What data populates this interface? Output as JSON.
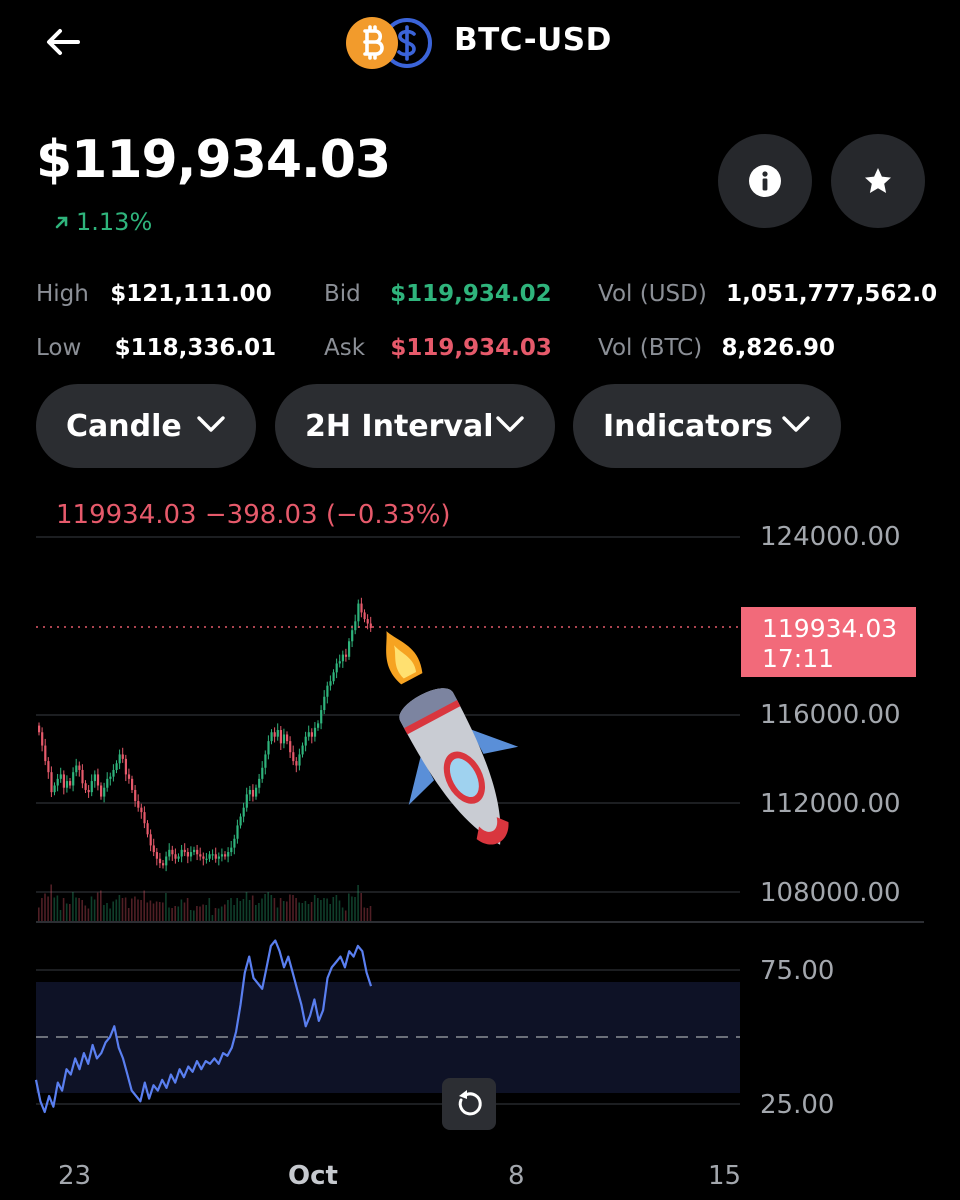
{
  "header": {
    "title": "BTC-USD",
    "coin_icons": [
      "bitcoin-icon",
      "dollar-icon"
    ]
  },
  "price": {
    "value": "$119,934.03",
    "change": "1.13%",
    "change_direction": "up"
  },
  "actions": {
    "info_icon": "info-icon",
    "favorite_icon": "star-icon"
  },
  "stats": {
    "high_label": "High",
    "high_value": "$121,111.00",
    "low_label": "Low",
    "low_value": "$118,336.01",
    "bid_label": "Bid",
    "bid_value": "$119,934.02",
    "ask_label": "Ask",
    "ask_value": "$119,934.03",
    "vol_usd_label": "Vol (USD)",
    "vol_usd_value": "1,051,777,562.0",
    "vol_btc_label": "Vol (BTC)",
    "vol_btc_value": "8,826.90"
  },
  "controls": {
    "chart_type": "Candle",
    "interval": "2H Interval",
    "indicators": "Indicators"
  },
  "chart": {
    "legend": "119934.03  −398.03 (−0.33%)",
    "price_axis": [
      "124000.00",
      "116000.00",
      "112000.00",
      "108000.00"
    ],
    "current_price_tag": "119934.03",
    "current_time_tag": "17:11",
    "rsi_axis": [
      "75.00",
      "25.00"
    ],
    "time_axis": [
      "23",
      "Oct",
      "8",
      "15"
    ]
  },
  "colors": {
    "up": "#2fb47c",
    "down": "#e65a6b",
    "rsi": "#5a7ff0",
    "background": "#000000",
    "pill": "#2b2d31"
  },
  "chart_data": {
    "type": "candlestick",
    "ylim": [
      107000,
      125000
    ],
    "y_ticks": [
      124000,
      116000,
      112000,
      108000
    ],
    "x_tick_labels": [
      "23",
      "Oct",
      "8",
      "15"
    ],
    "current_price": 119934.03,
    "close": [
      115200,
      114600,
      113900,
      113400,
      112500,
      112800,
      113100,
      113300,
      112700,
      113000,
      112800,
      113400,
      113700,
      113500,
      112900,
      112600,
      112500,
      113000,
      113300,
      112800,
      112300,
      112700,
      113100,
      113200,
      113500,
      113800,
      114200,
      114000,
      113300,
      113100,
      112600,
      112100,
      111800,
      111600,
      111100,
      110600,
      110100,
      109800,
      109500,
      109300,
      109200,
      109600,
      109900,
      109700,
      109500,
      109600,
      109900,
      109800,
      109600,
      109800,
      109900,
      109700,
      109600,
      109500,
      109500,
      109700,
      109700,
      109500,
      109600,
      109700,
      109600,
      109800,
      110000,
      110400,
      111000,
      111400,
      111800,
      112400,
      112600,
      112300,
      112700,
      113100,
      113600,
      114200,
      114800,
      115200,
      115000,
      115300,
      114700,
      115100,
      114800,
      114300,
      113900,
      113700,
      114200,
      114600,
      115000,
      115200,
      115000,
      115400,
      115600,
      116200,
      116800,
      117300,
      117500,
      117900,
      118300,
      118400,
      118700,
      118600,
      119300,
      119800,
      120200,
      121000,
      120600,
      120300,
      120100,
      119900
    ],
    "rsi": {
      "ylim": [
        10,
        90
      ],
      "levels": [
        75,
        50,
        25
      ],
      "values": [
        34,
        26,
        22,
        28,
        24,
        33,
        30,
        38,
        36,
        42,
        38,
        44,
        40,
        47,
        42,
        44,
        48,
        50,
        54,
        46,
        42,
        36,
        30,
        28,
        26,
        33,
        27,
        32,
        30,
        34,
        31,
        36,
        33,
        38,
        35,
        39,
        37,
        41,
        38,
        41,
        40,
        42,
        40,
        44,
        43,
        46,
        52,
        62,
        74,
        80,
        72,
        70,
        68,
        76,
        84,
        86,
        82,
        76,
        80,
        74,
        68,
        62,
        54,
        58,
        64,
        56,
        60,
        72,
        76,
        78,
        80,
        76,
        82,
        80,
        84,
        82,
        74,
        69
      ]
    }
  }
}
